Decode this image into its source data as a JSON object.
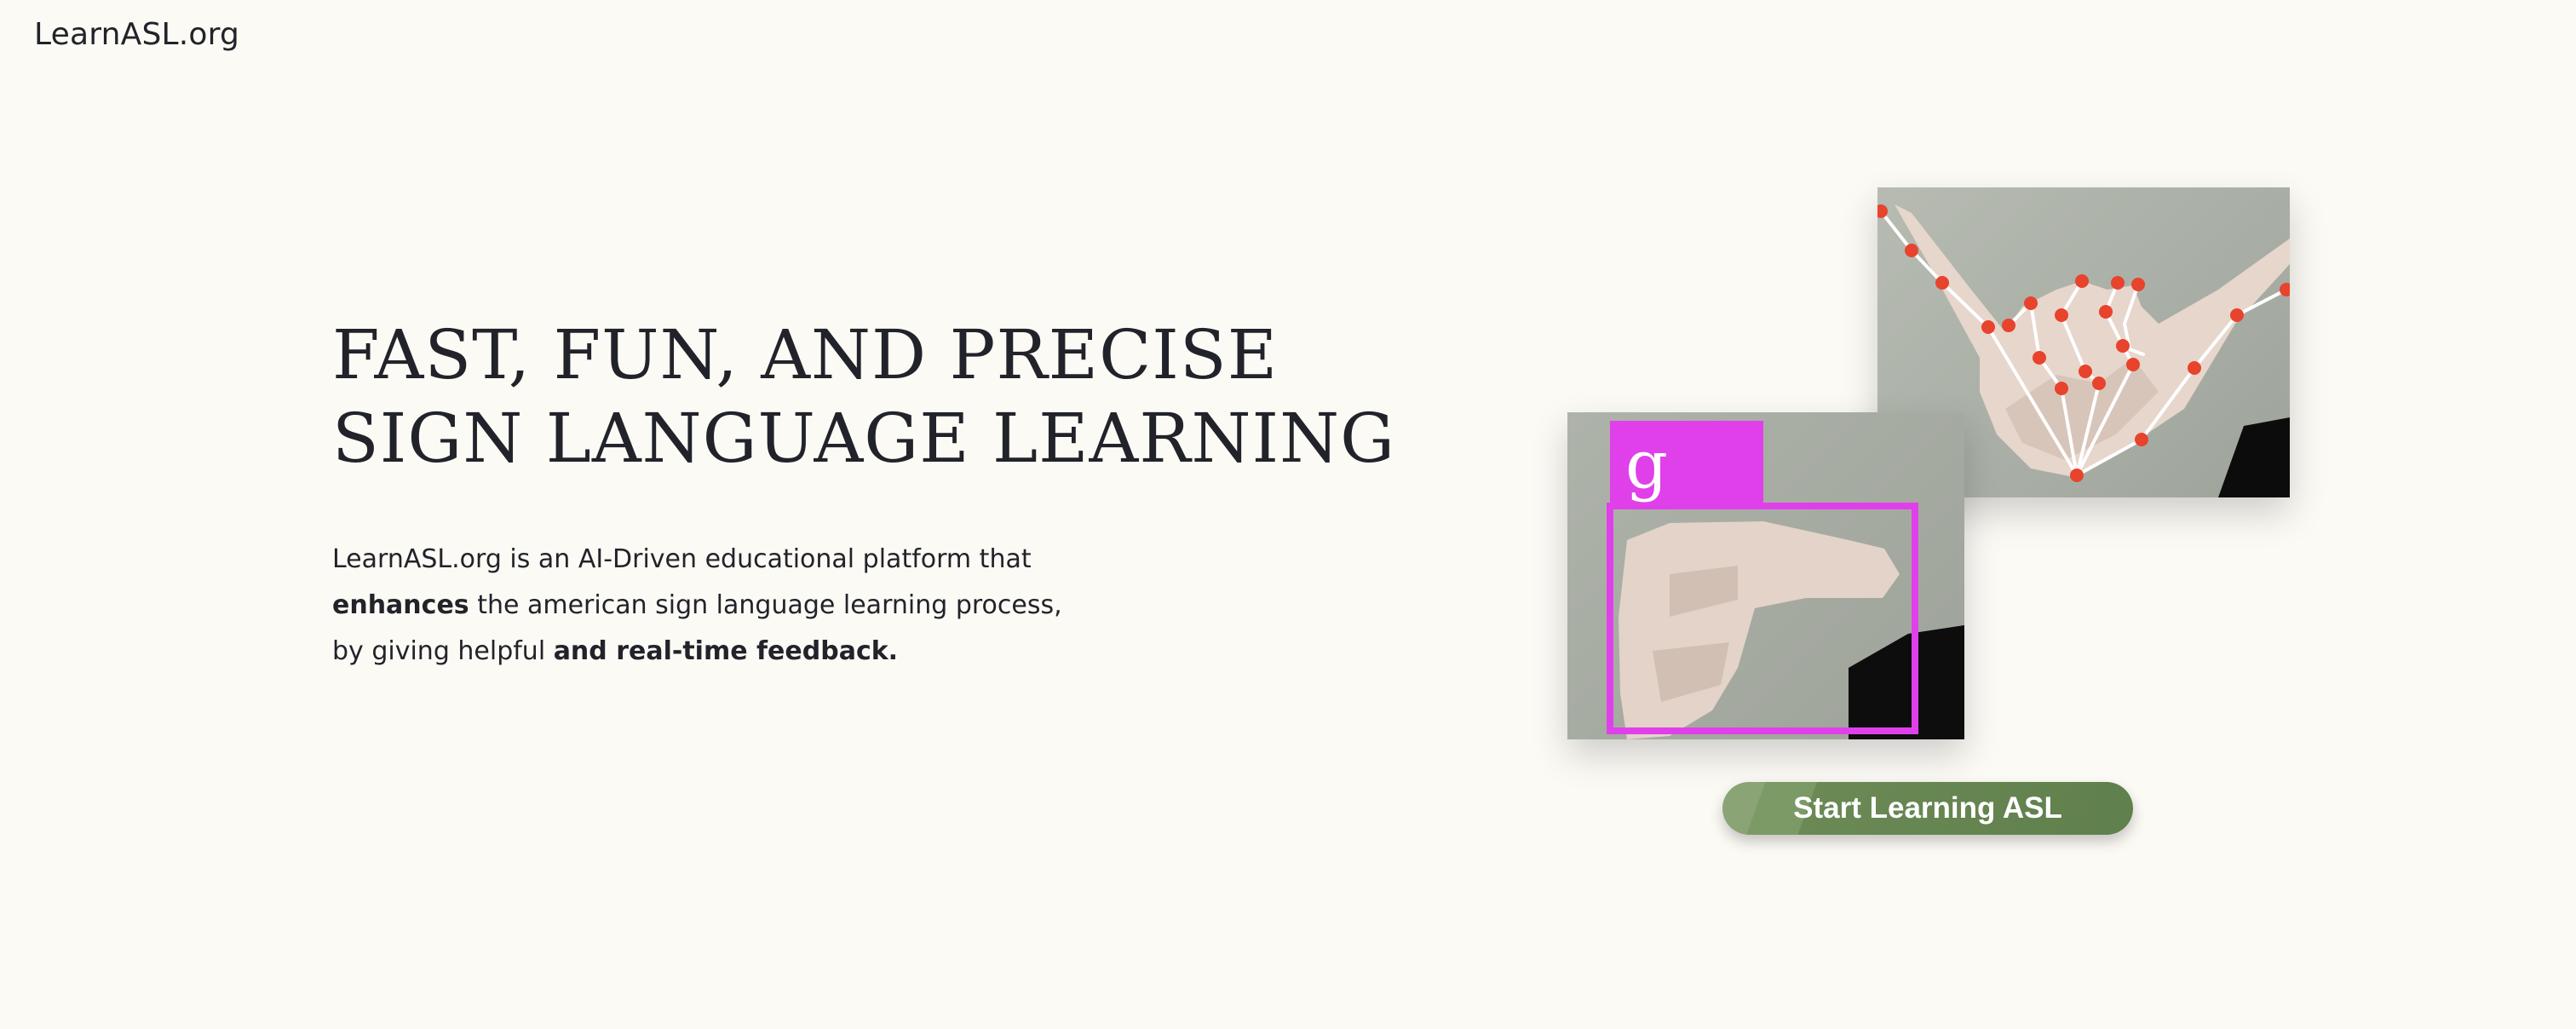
{
  "header": {
    "logo_text": "LearnASL.org"
  },
  "hero": {
    "title": "FAST, FUN, AND PRECISE SIGN LANGUAGE LEARNING",
    "description": {
      "part1": "LearnASL.org is an AI-Driven educational platform that ",
      "bold1": "enhances",
      "part2": " the american sign language learning process, by giving helpful ",
      "bold2": "and real-time feedback."
    },
    "demo": {
      "detected_letter": "g",
      "letter_box_color": "#e040ea",
      "landmark_color": "#e8432c"
    },
    "cta_label": "Start Learning ASL"
  },
  "colors": {
    "background": "#fcfaf5",
    "text": "#22232a",
    "cta": "#5f7f4c"
  }
}
